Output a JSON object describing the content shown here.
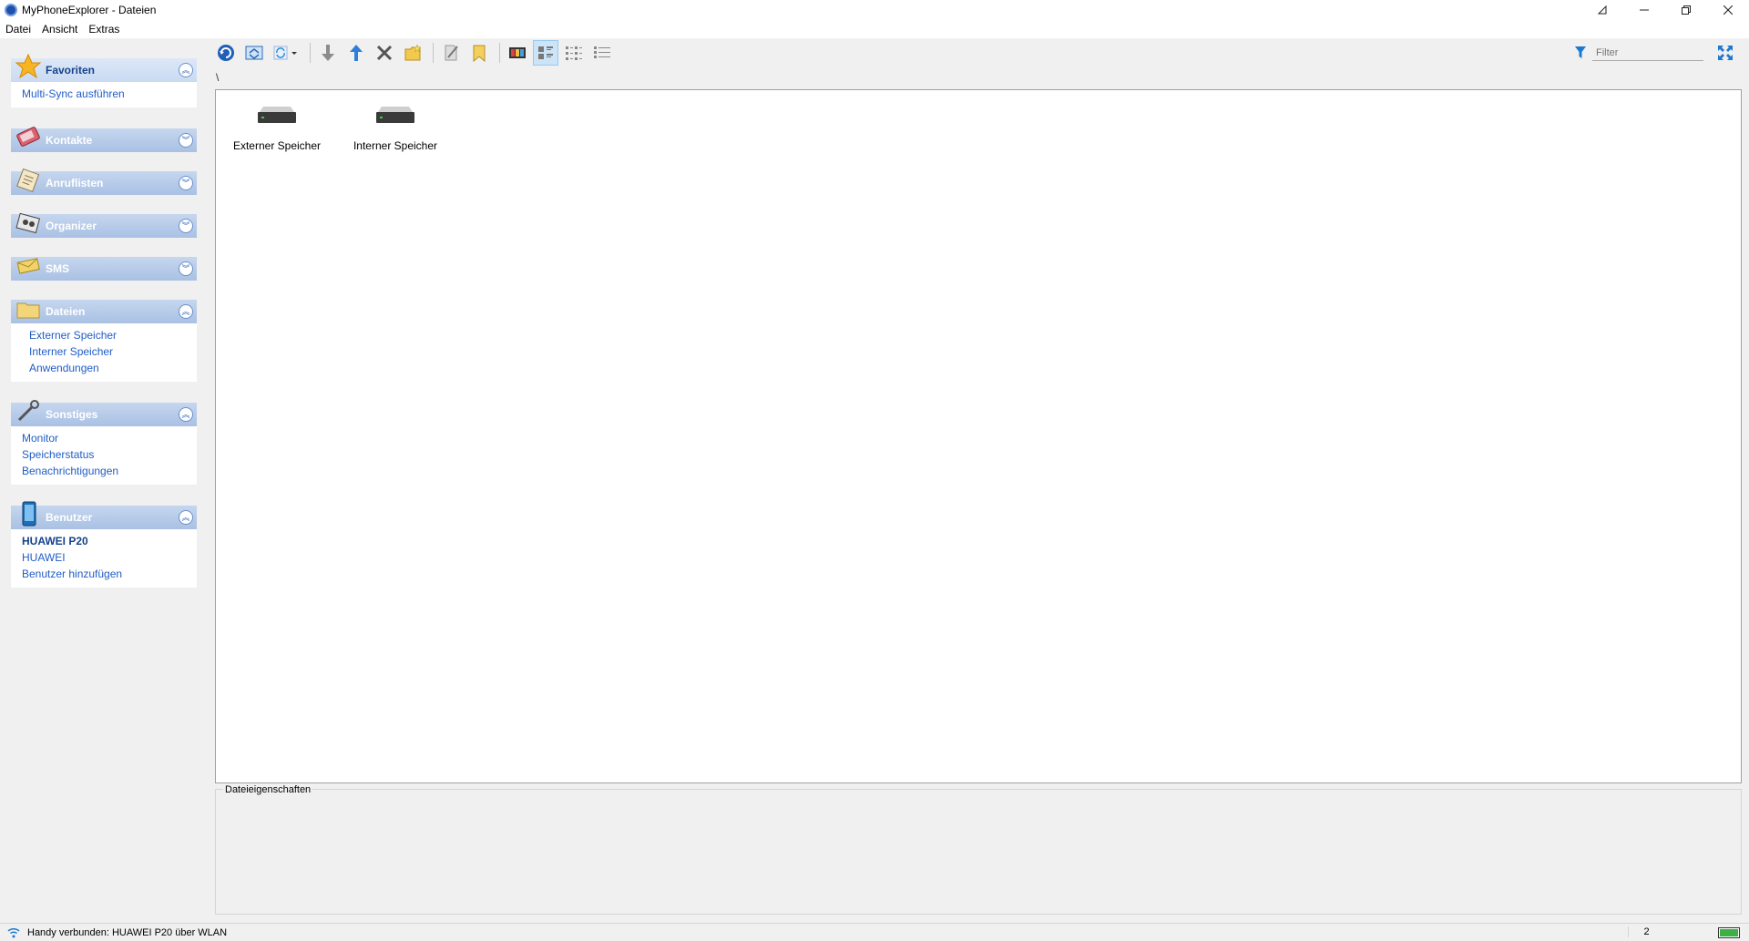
{
  "window": {
    "title": "MyPhoneExplorer -  Dateien",
    "controls": [
      "pin-icon",
      "minimize-icon",
      "restore-icon",
      "close-icon"
    ]
  },
  "menu": [
    "Datei",
    "Ansicht",
    "Extras"
  ],
  "sidebar": {
    "favoriten": {
      "title": "Favoriten",
      "items": [
        "Multi-Sync ausführen"
      ]
    },
    "kontakte": {
      "title": "Kontakte"
    },
    "anruflisten": {
      "title": "Anruflisten"
    },
    "organizer": {
      "title": "Organizer"
    },
    "sms": {
      "title": "SMS"
    },
    "dateien": {
      "title": "Dateien",
      "items": [
        "Externer Speicher",
        "Interner Speicher",
        "Anwendungen"
      ]
    },
    "sonstiges": {
      "title": "Sonstiges",
      "items": [
        "Monitor",
        "Speicherstatus",
        "Benachrichtigungen"
      ]
    },
    "benutzer": {
      "title": "Benutzer",
      "items": [
        "HUAWEI P20",
        "HUAWEI",
        "Benutzer hinzufügen"
      ]
    }
  },
  "toolbar": {
    "filter_placeholder": "Filter"
  },
  "path": "\\",
  "content": {
    "items": [
      {
        "label": "Externer Speicher",
        "icon": "drive-icon"
      },
      {
        "label": "Interner Speicher",
        "icon": "drive-icon"
      }
    ]
  },
  "properties": {
    "label": "Dateieigenschaften"
  },
  "status": {
    "text": "Handy verbunden: HUAWEI P20 über WLAN",
    "count": "2",
    "battery_level": 1.0
  }
}
